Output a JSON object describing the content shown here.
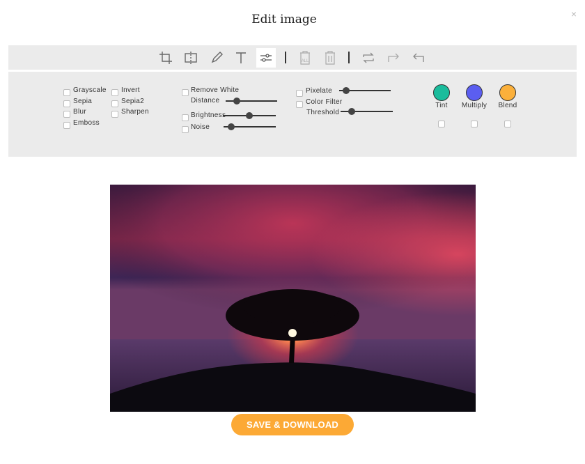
{
  "dialog": {
    "title": "Edit image",
    "close_icon": "×"
  },
  "toolbar": {
    "tools": [
      {
        "name": "crop-icon"
      },
      {
        "name": "flip-icon"
      },
      {
        "name": "pencil-icon"
      },
      {
        "name": "text-icon"
      },
      {
        "name": "filters-icon",
        "active": true
      },
      {
        "name": "delete-all-icon",
        "label": "ALL"
      },
      {
        "name": "trash-icon"
      },
      {
        "name": "repeat-icon"
      },
      {
        "name": "redo-icon"
      },
      {
        "name": "undo-icon"
      }
    ]
  },
  "filters": {
    "col1": [
      "Grayscale",
      "Sepia",
      "Blur",
      "Emboss"
    ],
    "col2": [
      "Invert",
      "Sepia2",
      "Sharpen"
    ],
    "remove_white": {
      "label": "Remove White",
      "distance_label": "Distance",
      "distance_value": 0.22
    },
    "brightness": {
      "label": "Brightness",
      "value": 0.5
    },
    "noise": {
      "label": "Noise",
      "value": 0.15
    },
    "pixelate": {
      "label": "Pixelate",
      "value": 0.13
    },
    "color_filter": {
      "label": "Color Filter",
      "threshold_label": "Threshold",
      "threshold_value": 0.21
    },
    "blends": [
      {
        "label": "Tint",
        "color": "#1abc9c"
      },
      {
        "label": "Multiply",
        "color": "#5b5ef0"
      },
      {
        "label": "Blend",
        "color": "#fbb03b"
      }
    ]
  },
  "actions": {
    "save_label": "SAVE & DOWNLOAD",
    "accent": "#fca935"
  }
}
